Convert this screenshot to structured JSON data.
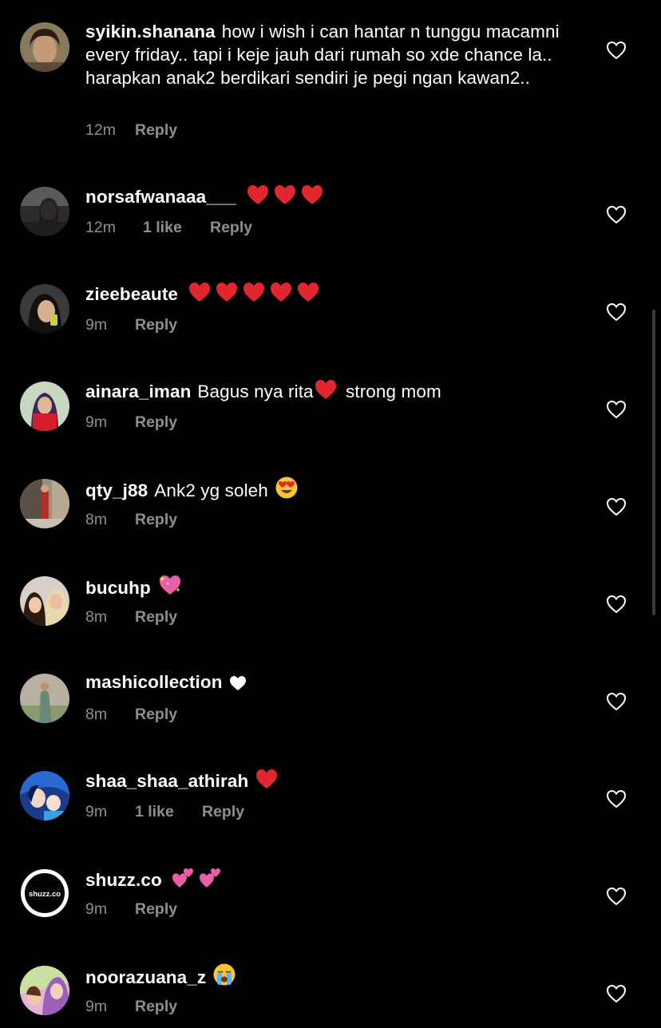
{
  "colors": {
    "background": "#000000",
    "text": "#ffffff",
    "meta": "#8e8e8e",
    "red_heart": "#e0262e",
    "sparkle_heart": "#e75fa6"
  },
  "comments": [
    {
      "username": "syikin.shanana",
      "text": "how i wish i can hantar n tunggu macamni every friday.. tapi i keje jauh dari rumah so xde chance la.. harapkan anak2 berdikari sendiri je pegi ngan kawan2..",
      "emojis": [],
      "time": "12m",
      "likes": "",
      "reply": "Reply"
    },
    {
      "username": "norsafwanaaa___",
      "text": "",
      "emojis": [
        "red-heart-emoji",
        "red-heart-emoji",
        "red-heart-emoji"
      ],
      "time": "12m",
      "likes": "1 like",
      "reply": "Reply"
    },
    {
      "username": "zieebeaute",
      "text": "",
      "emojis": [
        "red-heart-emoji",
        "red-heart-emoji",
        "red-heart-emoji",
        "red-heart-emoji",
        "red-heart-emoji"
      ],
      "time": "9m",
      "likes": "",
      "reply": "Reply"
    },
    {
      "username": "ainara_iman",
      "text": "Bagus nya rita",
      "text_after": "strong mom",
      "emojis": [
        "red-heart-emoji"
      ],
      "time": "9m",
      "likes": "",
      "reply": "Reply"
    },
    {
      "username": "qty_j88",
      "text": "Ank2 yg soleh",
      "emojis": [
        "heart-eyes-emoji"
      ],
      "time": "8m",
      "likes": "",
      "reply": "Reply"
    },
    {
      "username": "bucuhp",
      "text": "",
      "emojis": [
        "sparkling-heart-emoji"
      ],
      "time": "8m",
      "likes": "",
      "reply": "Reply"
    },
    {
      "username": "mashicollection",
      "text": "",
      "emojis": [
        "white-heart-emoji"
      ],
      "time": "8m",
      "likes": "",
      "reply": "Reply"
    },
    {
      "username": "shaa_shaa_athirah",
      "text": "",
      "emojis": [
        "red-heart-emoji"
      ],
      "time": "9m",
      "likes": "1 like",
      "reply": "Reply"
    },
    {
      "username": "shuzz.co",
      "text": "",
      "emojis": [
        "two-hearts-emoji",
        "two-hearts-emoji"
      ],
      "time": "9m",
      "likes": "",
      "reply": "Reply",
      "avatar_logo_text": "shuzz.co"
    },
    {
      "username": "noorazuana_z",
      "text": "",
      "emojis": [
        "loudly-crying-face-emoji"
      ],
      "time": "9m",
      "likes": "",
      "reply": "Reply"
    }
  ]
}
